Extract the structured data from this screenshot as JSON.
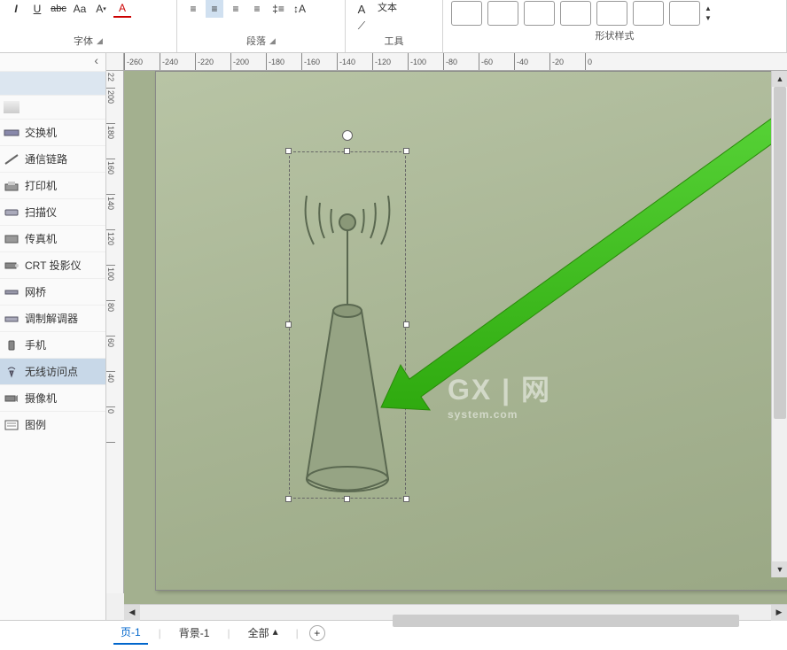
{
  "ribbon": {
    "font": {
      "label": "字体"
    },
    "paragraph": {
      "label": "段落"
    },
    "tools": {
      "label": "工具",
      "textbox": "文本"
    },
    "shapestyles": {
      "label": "形状样式"
    }
  },
  "ruler_h": [
    "-260",
    "-240",
    "-220",
    "-200",
    "-180",
    "-160",
    "-140",
    "-120",
    "-100",
    "-80",
    "-60",
    "-40",
    "-20",
    "0"
  ],
  "ruler_v": [
    "22",
    "200",
    "180",
    "160",
    "140",
    "120",
    "100",
    "80",
    "60",
    "40",
    "0"
  ],
  "stencils": [
    {
      "label": "",
      "key": "blank1"
    },
    {
      "label": "",
      "key": "blank2"
    },
    {
      "label": "交换机",
      "key": "switch"
    },
    {
      "label": "通信链路",
      "key": "comm-link"
    },
    {
      "label": "打印机",
      "key": "printer"
    },
    {
      "label": "扫描仪",
      "key": "scanner"
    },
    {
      "label": "传真机",
      "key": "fax"
    },
    {
      "label": "CRT 投影仪",
      "key": "crt-projector"
    },
    {
      "label": "网桥",
      "key": "bridge"
    },
    {
      "label": "调制解调器",
      "key": "modem"
    },
    {
      "label": "手机",
      "key": "phone"
    },
    {
      "label": "无线访问点",
      "key": "wireless-ap"
    },
    {
      "label": "摄像机",
      "key": "camera"
    },
    {
      "label": "图例",
      "key": "legend"
    }
  ],
  "tabs": {
    "page": "页-1",
    "background": "背景-1",
    "all": "全部"
  },
  "watermark": {
    "main": "GX | 网",
    "sub": "system.com"
  }
}
